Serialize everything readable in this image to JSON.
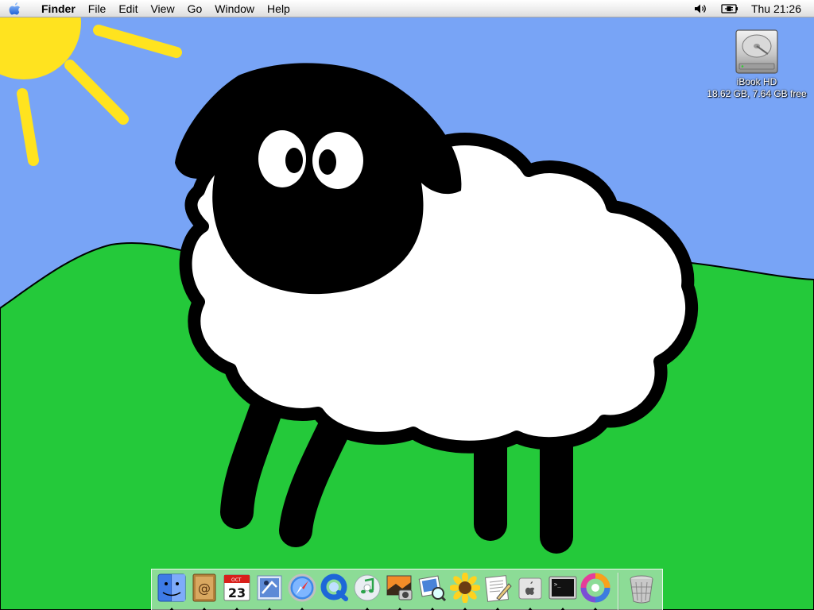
{
  "menubar": {
    "apple_icon": "apple-logo-icon",
    "items": [
      {
        "label": "Finder",
        "bold": true
      },
      {
        "label": "File"
      },
      {
        "label": "Edit"
      },
      {
        "label": "View"
      },
      {
        "label": "Go"
      },
      {
        "label": "Window"
      },
      {
        "label": "Help"
      }
    ],
    "status": {
      "volume_icon": "volume-icon",
      "power_icon": "power-adapter-icon",
      "clock": "Thu 21:26"
    }
  },
  "desktop_icon": {
    "icon": "hard-drive-icon",
    "name": "iBook HD",
    "info": "18.62 GB, 7.64 GB free"
  },
  "wallpaper": {
    "sky_color": "#78a4f6",
    "grass_color": "#24c93a",
    "sun_color": "#ffe31f"
  },
  "dock": {
    "apps": [
      {
        "name": "finder",
        "icon": "finder-icon",
        "running": true
      },
      {
        "name": "address-book",
        "icon": "address-book-icon",
        "running": true
      },
      {
        "name": "ical",
        "icon": "calendar-icon",
        "running": true,
        "month": "OCT",
        "day": "23"
      },
      {
        "name": "mail",
        "icon": "mail-icon",
        "running": true
      },
      {
        "name": "safari",
        "icon": "safari-compass-icon",
        "running": true
      },
      {
        "name": "quicktime",
        "icon": "quicktime-icon",
        "running": false
      },
      {
        "name": "itunes",
        "icon": "itunes-icon",
        "running": true
      },
      {
        "name": "iphoto",
        "icon": "iphoto-icon",
        "running": true
      },
      {
        "name": "preview",
        "icon": "preview-icon",
        "running": true
      },
      {
        "name": "system-preferences",
        "icon": "sunflower-icon",
        "running": true
      },
      {
        "name": "textedit",
        "icon": "textedit-icon",
        "running": true
      },
      {
        "name": "apple-system-profiler",
        "icon": "apple-box-icon",
        "running": true
      },
      {
        "name": "terminal",
        "icon": "terminal-icon",
        "running": true
      },
      {
        "name": "color-sync",
        "icon": "colorsync-icon",
        "running": true
      }
    ],
    "trash": {
      "icon": "trash-icon"
    }
  }
}
